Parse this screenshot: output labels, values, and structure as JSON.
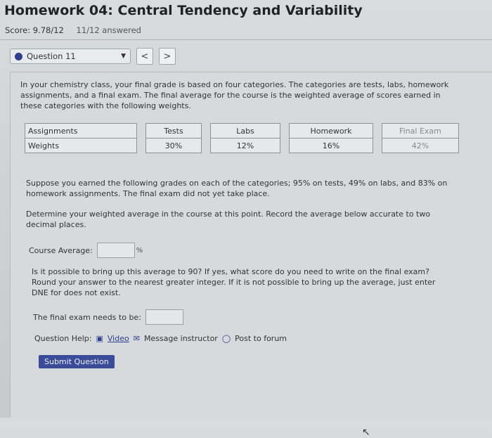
{
  "header": {
    "title": "Homework 04: Central Tendency and Variability",
    "score": "Score: 9.78/12",
    "answered": "11/12 answered"
  },
  "question_nav": {
    "selected": "Question 11",
    "prev": "<",
    "next": ">"
  },
  "question": {
    "intro": "In your chemistry class, your final grade is based on four categories. The categories are tests, labs, homework assignments, and a final exam. The final average for the course is the weighted average of scores earned in these categories with the following weights.",
    "table": {
      "row1": [
        "Assignments",
        "Tests",
        "Labs",
        "Homework",
        "Final Exam"
      ],
      "row2": [
        "Weights",
        "30%",
        "12%",
        "16%",
        "42%"
      ]
    },
    "scenario": "Suppose you earned the following grades on each of the categories; 95% on tests, 49% on labs, and 83% on homework assignments. The final exam did not yet take place.",
    "instruction": "Determine your weighted average in the course at this point. Record the average below accurate to two decimal places.",
    "avg_label": "Course Average:",
    "avg_value": "",
    "pct": "%",
    "followup": "Is it possible to bring up this average to 90? If yes, what score do you need to write on the final exam? Round your answer to the nearest greater integer. If it is not possible to bring up the average, just enter DNE for does not exist.",
    "final_label": "The final exam needs to be:",
    "final_value": ""
  },
  "help": {
    "label": "Question Help:",
    "video": "Video",
    "message": "Message instructor",
    "forum": "Post to forum"
  },
  "submit_label": "Submit Question"
}
